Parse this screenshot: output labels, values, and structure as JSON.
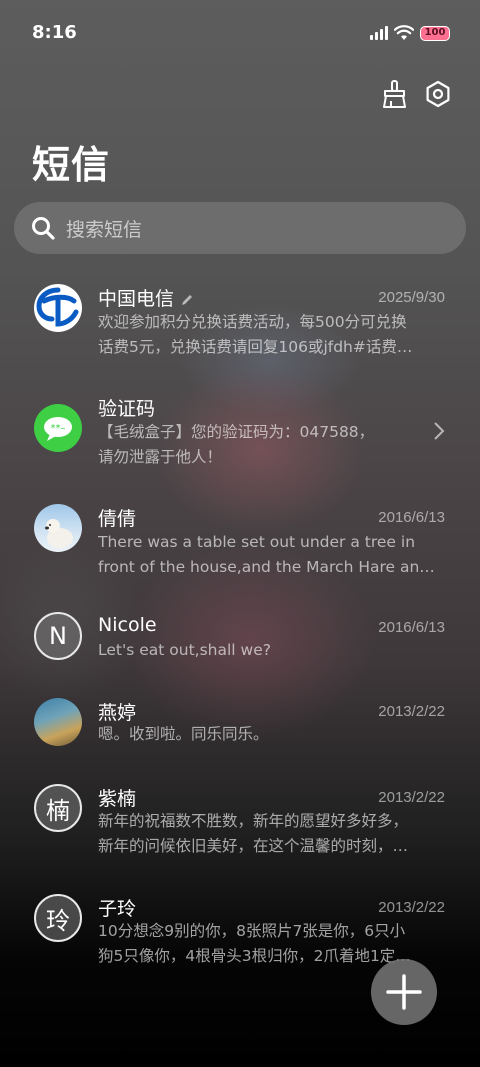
{
  "status": {
    "time": "8:16",
    "battery": "100",
    "battery_color": "#ff6f8f"
  },
  "header": {
    "title": "短信",
    "icons": [
      "broom-icon",
      "settings-icon"
    ]
  },
  "search": {
    "placeholder": "搜索短信"
  },
  "conversations": [
    {
      "name": "中国电信",
      "date": "2025/9/30",
      "preview1": "欢迎参加积分兑换话费活动，每500分可兑换",
      "preview2": "话费5元，兑换话费请回复106或jfdh#话费…",
      "avatar": "china-telecom-logo"
    },
    {
      "name": "验证码",
      "date": "",
      "preview1": "【毛绒盒子】您的验证码为：047588，",
      "preview2": "请勿泄露于他人！",
      "avatar": "message-bubble-icon"
    },
    {
      "name": "倩倩",
      "date": "2016/6/13",
      "preview1": "There was a table set out under a tree in",
      "preview2": "front of the house,and the March Hare an…",
      "avatar": "polar-bear-photo"
    },
    {
      "name": "Nicole",
      "date": "2016/6/13",
      "preview1": "Let's eat out,shall we?",
      "preview2": "",
      "avatar_letter": "N"
    },
    {
      "name": "燕婷",
      "date": "2013/2/22",
      "preview1": "嗯。收到啦。同乐同乐。",
      "preview2": "",
      "avatar": "landscape-photo"
    },
    {
      "name": "紫楠",
      "date": "2013/2/22",
      "preview1": "新年的祝福数不胜数，新年的愿望好多好多，",
      "preview2": "新年的问候依旧美好，在这个温馨的时刻，…",
      "avatar_letter": "楠"
    },
    {
      "name": "子玲",
      "date": "2013/2/22",
      "preview1": "10分想念9别的你，8张照片7张是你，6只小",
      "preview2": "狗5只像你，4根骨头3根归你，2爪着地1定…",
      "avatar_letter": "玲"
    }
  ],
  "fab": {
    "icon": "plus-icon"
  }
}
